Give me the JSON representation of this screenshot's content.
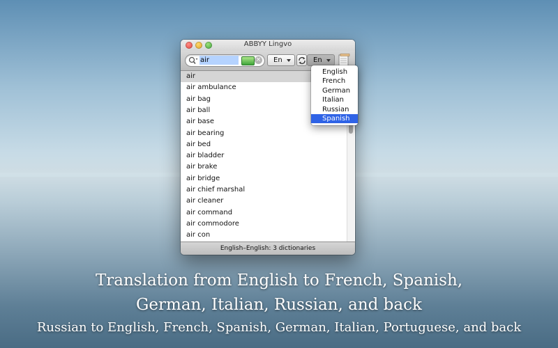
{
  "window": {
    "title": "ABBYY Lingvo"
  },
  "search": {
    "value": "air"
  },
  "toolbar": {
    "source_language": "En",
    "target_language": "En"
  },
  "word_list": {
    "selected_index": 0,
    "items": [
      "air",
      "air ambulance",
      "air bag",
      "air ball",
      "air base",
      "air bearing",
      "air bed",
      "air bladder",
      "air brake",
      "air bridge",
      "air chief marshal",
      "air cleaner",
      "air command",
      "air commodore",
      "air con"
    ]
  },
  "language_menu": {
    "options": [
      "English",
      "French",
      "German",
      "Italian",
      "Russian",
      "Spanish"
    ],
    "selected": "Spanish"
  },
  "status_bar": {
    "text": "English–English: 3 dictionaries"
  },
  "caption": {
    "line1": "Translation from English to French, Spanish,",
    "line2": "German, Italian, Russian, and back",
    "line3": "Russian to English, French, Spanish, German, Italian, Portuguese, and back"
  },
  "colors": {
    "selection_blue": "#2f63e6",
    "search_highlight": "#b5d3ff",
    "list_selected_row": "#d5d5d5"
  }
}
